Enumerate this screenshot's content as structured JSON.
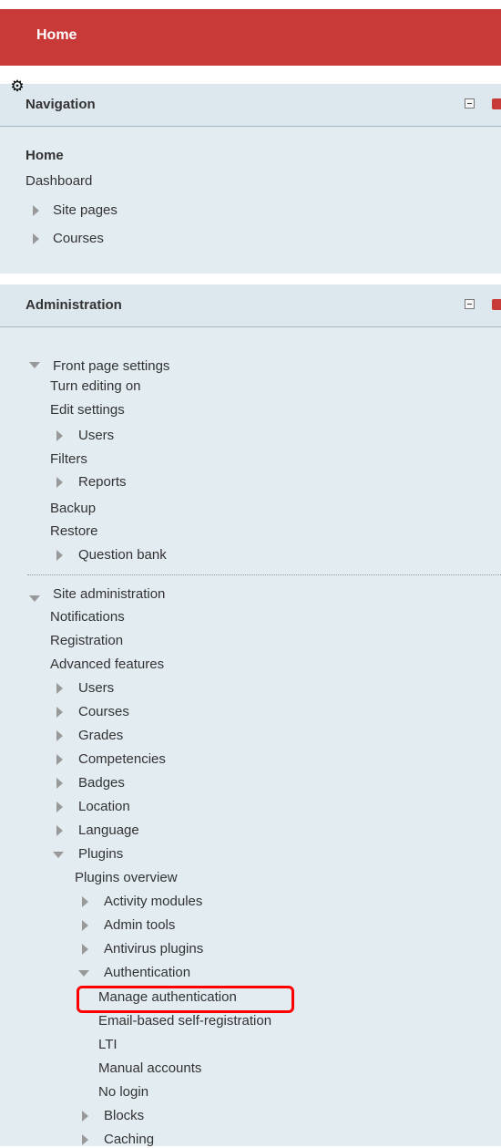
{
  "header": {
    "title": "Home"
  },
  "navigation": {
    "title": "Navigation",
    "items": [
      {
        "label": "Home"
      },
      {
        "label": "Dashboard"
      },
      {
        "label": "Site pages"
      },
      {
        "label": "Courses"
      }
    ]
  },
  "administration": {
    "title": "Administration",
    "front_page": {
      "label": "Front page settings",
      "items": [
        "Turn editing on",
        "Edit settings",
        "Users",
        "Filters",
        "Reports",
        "Backup",
        "Restore",
        "Question bank"
      ]
    },
    "site_admin": {
      "label": "Site administration",
      "items": [
        "Notifications",
        "Registration",
        "Advanced features",
        "Users",
        "Courses",
        "Grades",
        "Competencies",
        "Badges",
        "Location",
        "Language",
        "Plugins"
      ],
      "plugins": {
        "items": [
          "Plugins overview",
          "Activity modules",
          "Admin tools",
          "Antivirus plugins",
          "Authentication"
        ],
        "authentication": {
          "items": [
            "Manage authentication",
            "Email-based self-registration",
            "LTI",
            "Manual accounts",
            "No login"
          ]
        },
        "after": [
          "Blocks",
          "Caching"
        ]
      }
    }
  },
  "colors": {
    "header_bg": "#c83a37",
    "panel_bg": "#e3ecf1",
    "highlight": "#ff0000"
  }
}
